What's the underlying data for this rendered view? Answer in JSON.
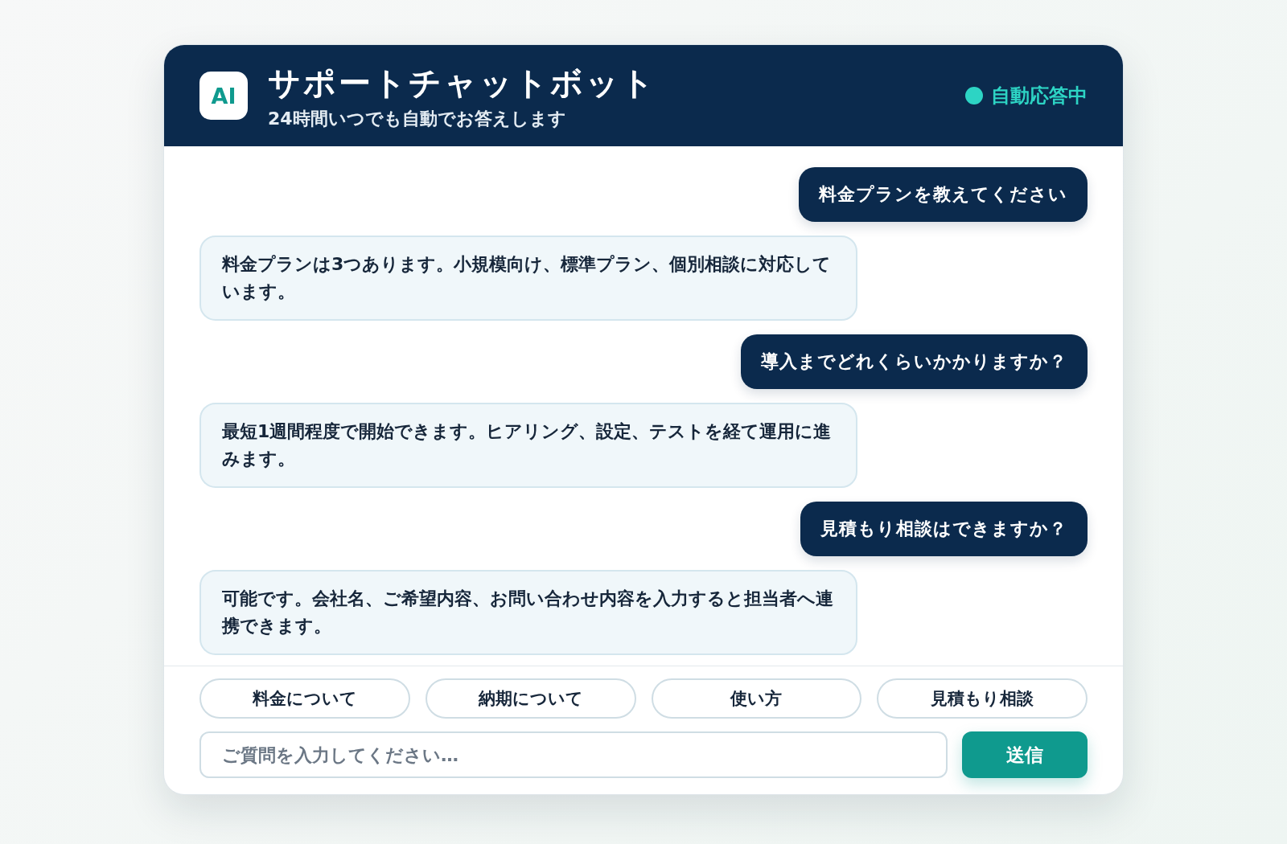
{
  "header": {
    "logo": "AI",
    "title": "サポートチャットボット",
    "subtitle": "24時間いつでも自動でお答えします",
    "status": "自動応答中"
  },
  "messages": [
    {
      "kind": "user",
      "text": "料金プランを教えてください"
    },
    {
      "kind": "bot",
      "text": "料金プランは3つあります。小規模向け、標準プラン、個別相談に対応しています。"
    },
    {
      "kind": "user",
      "text": "導入までどれくらいかかりますか？"
    },
    {
      "kind": "bot",
      "text": "最短1週間程度で開始できます。ヒアリング、設定、テストを経て運用に進みます。"
    },
    {
      "kind": "user",
      "text": "見積もり相談はできますか？"
    },
    {
      "kind": "bot",
      "text": "可能です。会社名、ご希望内容、お問い合わせ内容を入力すると担当者へ連携できます。"
    }
  ],
  "quick_replies": [
    "料金について",
    "納期について",
    "使い方",
    "見積もり相談"
  ],
  "input": {
    "placeholder": "ご質問を入力してください…"
  },
  "send_button": "送信"
}
